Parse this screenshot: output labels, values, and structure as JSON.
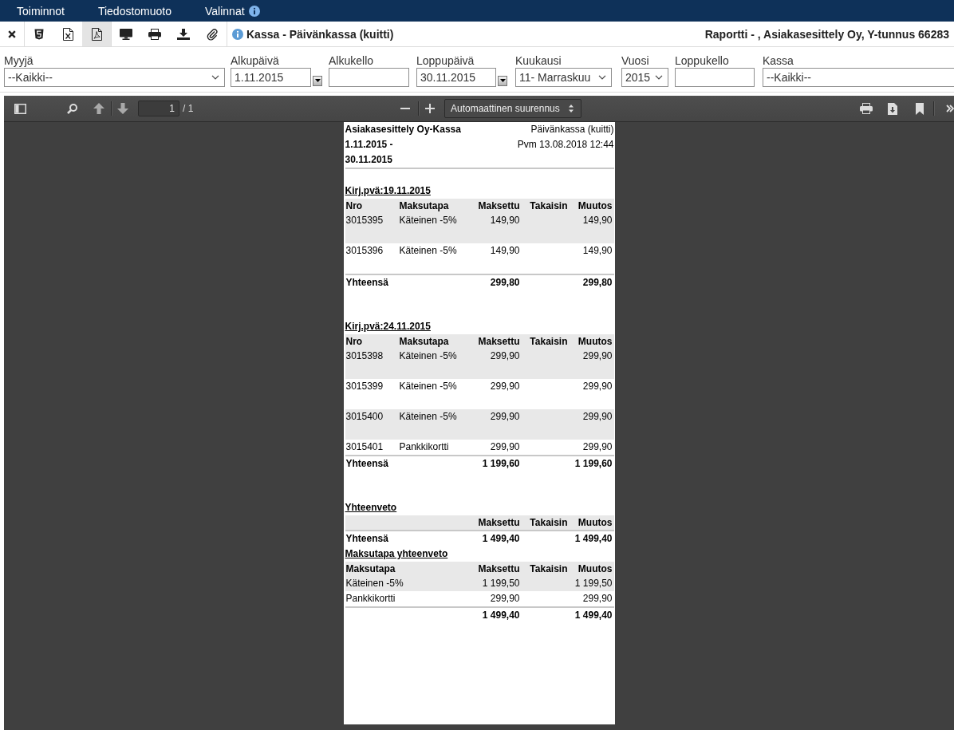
{
  "menu_bar": {
    "items": [
      {
        "label": "Toiminnot",
        "info": false
      },
      {
        "label": "Tiedostomuoto",
        "info": false
      },
      {
        "label": "Valinnat",
        "info": true
      }
    ]
  },
  "toolbar": {
    "groups": [
      {
        "buttons": [
          {
            "kind": "close",
            "selected": false
          }
        ]
      },
      {
        "buttons": [
          {
            "kind": "html",
            "selected": false
          },
          {
            "kind": "excel",
            "selected": false
          },
          {
            "kind": "pdf",
            "selected": true
          }
        ]
      },
      {
        "buttons": [
          {
            "kind": "screen",
            "selected": false
          },
          {
            "kind": "print",
            "selected": false
          },
          {
            "kind": "download",
            "selected": false
          },
          {
            "kind": "attach",
            "selected": false
          }
        ]
      }
    ],
    "title": "Kassa - Päivänkassa (kuitti)",
    "report_info": "Raportti - , Asiakasesittely Oy, Y-tunnus 66283"
  },
  "filters": [
    {
      "label": "Myyjä",
      "kind": "select",
      "value": "--Kaikki--"
    },
    {
      "label": "Alkupäivä",
      "kind": "date",
      "value": "1.11.2015"
    },
    {
      "label": "Alkukello",
      "kind": "text"
    },
    {
      "label": "Loppupäivä",
      "kind": "date",
      "value": "30.11.2015"
    },
    {
      "label": "Kuukausi",
      "kind": "select",
      "value": "11- Marraskuu"
    },
    {
      "label": "Vuosi",
      "kind": "select",
      "value": "2015"
    },
    {
      "label": "Loppukello",
      "kind": "text"
    },
    {
      "label": "Kassa",
      "kind": "select",
      "value": "--Kaikki--"
    }
  ],
  "pdf_viewer": {
    "toolbar": {
      "page_number": "1",
      "page_count": "/ 1",
      "zoom": "Automaattinen suurennus"
    },
    "document": {
      "header": {
        "company": "Asiakasesittely Oy-Kassa",
        "period_start": "1.11.2015 -",
        "period_end": "30.11.2015",
        "report_name": "Päivänkassa (kuitti)",
        "printed": "Pvm 13.08.2018 12:44"
      },
      "sections": [
        {
          "title": "Kirj.pvä:19.11.2015",
          "columns": [
            "Nro",
            "Maksutapa",
            "Maksettu",
            "Takaisin",
            "Muutos"
          ],
          "rows": [
            {
              "nro": "3015395",
              "maksutapa": "Käteinen -5%",
              "maksettu": "149,90",
              "muutos": "149,90",
              "tall": true
            },
            {
              "nro": "3015396",
              "maksutapa": "Käteinen -5%",
              "maksettu": "149,90",
              "muutos": "149,90",
              "tall": true
            }
          ],
          "total": {
            "label": "Yhteensä",
            "maksettu": "299,80",
            "muutos": "299,80"
          }
        },
        {
          "title": "Kirj.pvä:24.11.2015",
          "columns": [
            "Nro",
            "Maksutapa",
            "Maksettu",
            "Takaisin",
            "Muutos"
          ],
          "rows": [
            {
              "nro": "3015398",
              "maksutapa": "Käteinen -5%",
              "maksettu": "299,90",
              "muutos": "299,90",
              "tall": true
            },
            {
              "nro": "3015399",
              "maksutapa": "Käteinen -5%",
              "maksettu": "299,90",
              "muutos": "299,90",
              "tall": true
            },
            {
              "nro": "3015400",
              "maksutapa": "Käteinen -5%",
              "maksettu": "299,90",
              "muutos": "299,90",
              "tall": true
            },
            {
              "nro": "3015401",
              "maksutapa": "Pankkikortti",
              "maksettu": "299,90",
              "muutos": "299,90",
              "tall": false
            }
          ],
          "total": {
            "label": "Yhteensä",
            "maksettu": "1 199,60",
            "muutos": "1 199,60"
          }
        }
      ],
      "summary": {
        "title": "Yhteenveto",
        "columns": [
          "Maksettu",
          "Takaisin",
          "Muutos"
        ],
        "total": {
          "label": "Yhteensä",
          "maksettu": "1 499,40",
          "muutos": "1 499,40"
        }
      },
      "payment_summary": {
        "title": "Maksutapa yhteenveto",
        "columns": [
          "Maksutapa",
          "Maksettu",
          "Takaisin",
          "Muutos"
        ],
        "rows": [
          {
            "maksutapa": "Käteinen -5%",
            "maksettu": "1 199,50",
            "muutos": "1 199,50"
          },
          {
            "maksutapa": "Pankkikortti",
            "maksettu": "299,90",
            "muutos": "299,90"
          }
        ],
        "total": {
          "maksettu": "1 499,40",
          "muutos": "1 499,40"
        }
      }
    }
  }
}
